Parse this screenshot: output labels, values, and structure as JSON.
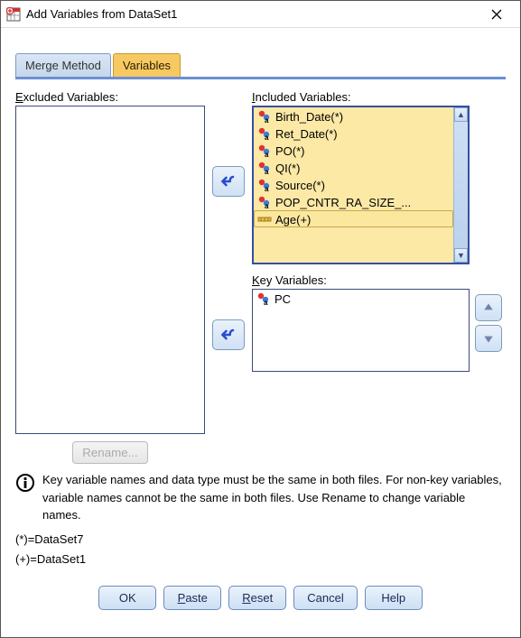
{
  "window": {
    "title": "Add Variables from DataSet1"
  },
  "tabs": {
    "merge": "Merge Method",
    "variables": "Variables"
  },
  "labels": {
    "excluded": "Excluded Variables:",
    "excluded_ul": "E",
    "included": "Included Variables:",
    "included_ul": "I",
    "key": "Key Variables:",
    "key_ul": "K",
    "rename": "Rename..."
  },
  "included": {
    "items": [
      "Birth_Date(*)",
      "Ret_Date(*)",
      "PO(*)",
      "QI(*)",
      "Source(*)",
      "POP_CNTR_RA_SIZE_...",
      "Age(+)"
    ]
  },
  "key": {
    "items": [
      "PC"
    ]
  },
  "info": "Key variable names and data type must be the same in both files. For non-key variables, variable names cannot be the same in both files. Use Rename to change variable names.",
  "legend": {
    "l1": "(*)=DataSet7",
    "l2": "(+)=DataSet1"
  },
  "buttons": {
    "ok": "OK",
    "paste": "Paste",
    "reset": "Reset",
    "cancel": "Cancel",
    "help": "Help"
  }
}
